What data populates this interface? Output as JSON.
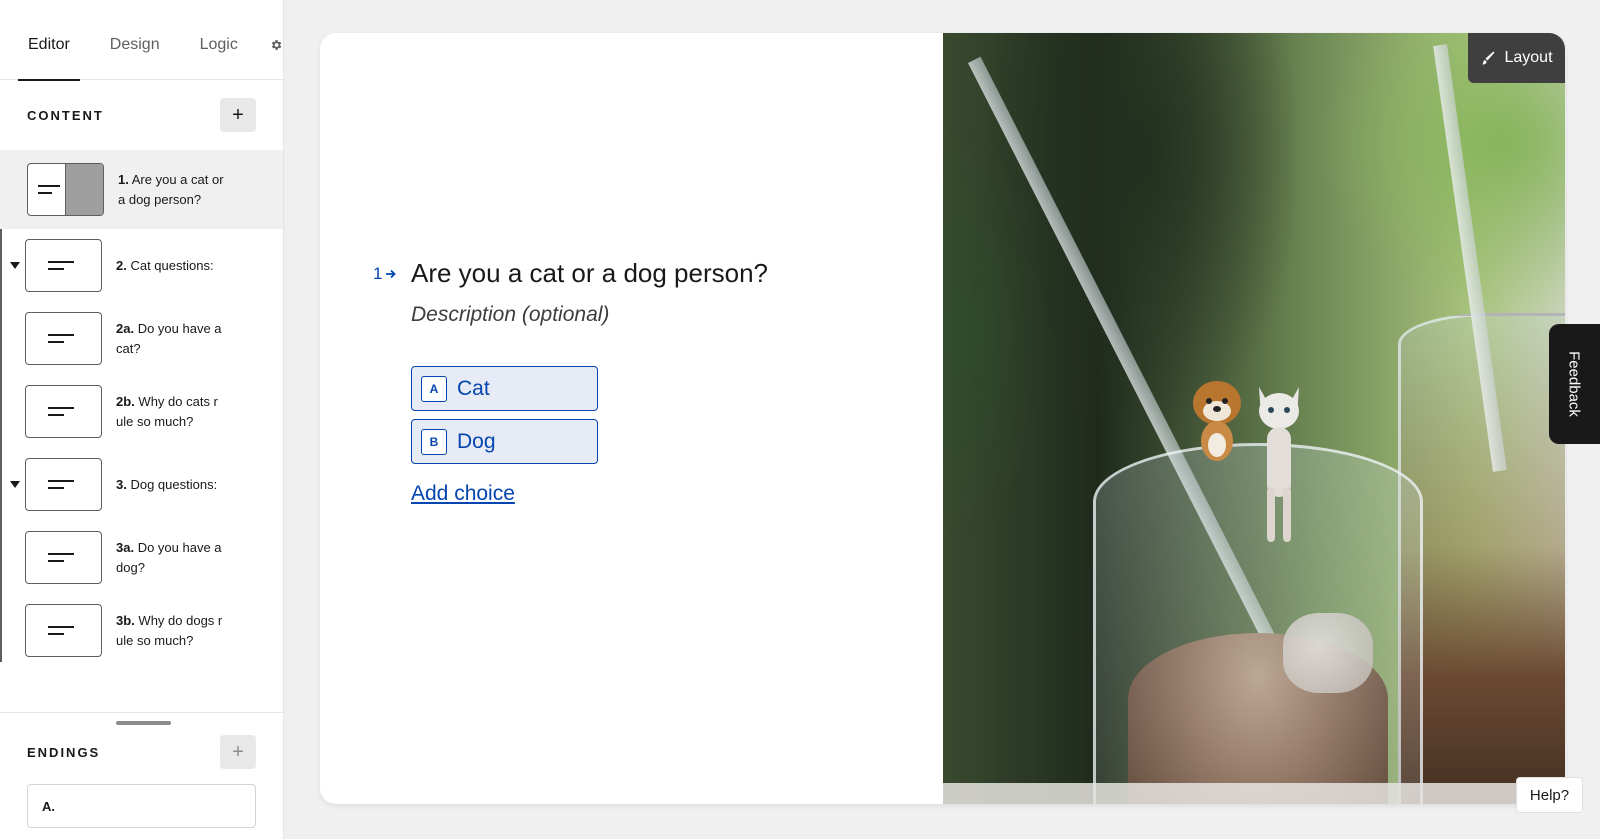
{
  "tabs": [
    {
      "label": "Editor",
      "active": true
    },
    {
      "label": "Design",
      "active": false
    },
    {
      "label": "Logic",
      "active": false
    }
  ],
  "settings_icon": "gear-icon",
  "content": {
    "title": "CONTENT",
    "add_label": "+",
    "items": [
      {
        "num": "1.",
        "text": "Are you a cat or a dog person?",
        "line1": "Are you a cat or",
        "line2": "a dog person?",
        "selected": true
      },
      {
        "num": "2.",
        "text": "Cat questions:",
        "group": true
      },
      {
        "num": "2a.",
        "line1": "Do you have a",
        "line2": "cat?"
      },
      {
        "num": "2b.",
        "line1": "Why do cats r",
        "line2": "ule so much?"
      },
      {
        "num": "3.",
        "text": "Dog questions:",
        "group": true
      },
      {
        "num": "3a.",
        "line1": "Do you have a",
        "line2": "dog?"
      },
      {
        "num": "3b.",
        "line1": "Why do dogs r",
        "line2": "ule so much?"
      }
    ]
  },
  "endings": {
    "title": "ENDINGS",
    "add_label": "+",
    "items": [
      {
        "label": "A."
      }
    ]
  },
  "question": {
    "number": "1",
    "title": "Are you a cat or a dog person?",
    "description": "Description (optional)",
    "choices": [
      {
        "key": "A",
        "label": "Cat"
      },
      {
        "key": "B",
        "label": "Dog"
      }
    ],
    "add_choice": "Add choice"
  },
  "layout_button": "Layout",
  "feedback": "Feedback",
  "help": "Help?",
  "colors": {
    "accent": "#0445af",
    "choice_bg": "#e6ebf5",
    "dark": "#191919"
  }
}
